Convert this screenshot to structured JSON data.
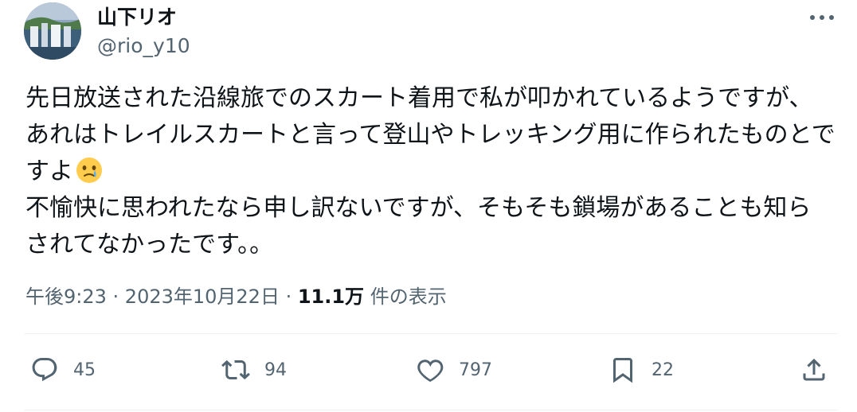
{
  "user": {
    "display_name": "山下リオ",
    "handle": "@rio_y10"
  },
  "tweet": {
    "lines": [
      "先日放送された沿線旅でのスカート着用で私が叩かれているようですが、",
      "あれはトレイルスカートと言って登山やトレッキング用に作られたものとで",
      "すよ",
      "不愉快に思われたなら申し訳ないですが、そもそも鎖場があることも知ら",
      "されてなかったです。。"
    ],
    "emoji": "face-holding-back-tears-icon"
  },
  "meta": {
    "time": "午後9:23",
    "separator_1": " · ",
    "date": "2023年10月22日",
    "separator_2": " · ",
    "views_count": "11.1万",
    "views_label": " 件の表示"
  },
  "actions": {
    "replies": "45",
    "retweets": "94",
    "likes": "797",
    "bookmarks": "22"
  },
  "colors": {
    "text": "#0f1419",
    "secondary": "#536471",
    "divider": "#eff3f4"
  }
}
